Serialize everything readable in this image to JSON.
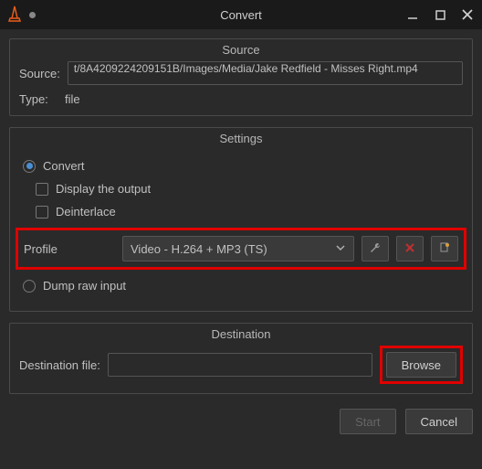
{
  "title": "Convert",
  "source": {
    "group_label": "Source",
    "source_label": "Source:",
    "source_value": "t/8A4209224209151B/Images/Media/Jake Redfield - Misses Right.mp4",
    "type_label": "Type:",
    "type_value": "file"
  },
  "settings": {
    "group_label": "Settings",
    "convert_label": "Convert",
    "display_output_label": "Display the output",
    "deinterlace_label": "Deinterlace",
    "profile_label": "Profile",
    "profile_value": "Video - H.264 + MP3 (TS)",
    "dump_label": "Dump raw input"
  },
  "destination": {
    "group_label": "Destination",
    "file_label": "Destination file:",
    "file_value": "",
    "browse_label": "Browse"
  },
  "footer": {
    "start_label": "Start",
    "cancel_label": "Cancel"
  }
}
